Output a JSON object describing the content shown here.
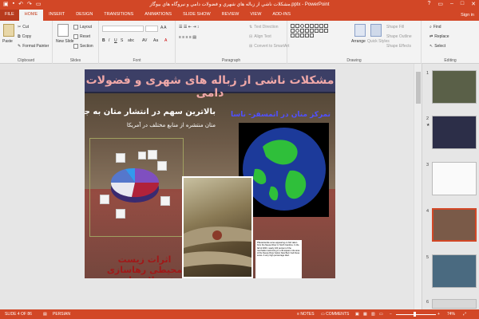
{
  "window": {
    "title": "مشكلات ناشي از زباله هاي شهري و فضولات دامي و نيروگاه هاي بيوگاز.pptx - PowerPoint",
    "signin": "Sign in"
  },
  "tabs": [
    "FILE",
    "HOME",
    "INSERT",
    "DESIGN",
    "TRANSITIONS",
    "ANIMATIONS",
    "SLIDE SHOW",
    "REVIEW",
    "VIEW",
    "ADD-INS"
  ],
  "ribbon": {
    "clipboard": {
      "label": "Clipboard",
      "paste": "Paste",
      "cut": "Cut",
      "copy": "Copy",
      "format_painter": "Format Painter"
    },
    "slides": {
      "label": "Slides",
      "new_slide": "New Slide",
      "layout": "Layout",
      "reset": "Reset",
      "section": "Section"
    },
    "font": {
      "label": "Font"
    },
    "paragraph": {
      "label": "Paragraph",
      "text_direction": "Text Direction",
      "align_text": "Align Text",
      "convert": "Convert to SmartArt"
    },
    "drawing": {
      "label": "Drawing",
      "arrange": "Arrange",
      "quick_styles": "Quick Styles",
      "shape_fill": "Shape Fill",
      "shape_outline": "Shape Outline",
      "shape_effects": "Shape Effects"
    },
    "editing": {
      "label": "Editing",
      "find": "Find",
      "replace": "Replace",
      "select": "Select"
    }
  },
  "slide": {
    "title": "مشکلات ناشی از زباله های شهری و فضولات دامی",
    "subtitle1": "بالاترین سهم در انتشار متان به جو:",
    "subtitle2": "متان منتشره از منابع مختلف در آمریکا",
    "globe_title": "تمرکز متان در اتمسفر- ناسا",
    "bottom_text": "اثرات زیست محیطی رهاسازی فضولات دامی",
    "caption": "Pfiesteria-like sores appearing on fish taken from the Neuse River in North Carolina. In the fall of 2003, nearly 100 percent of the menhaden swimming in a 40-square mile area of the Neuse River below New Bern had these sores. A very high percentage died."
  },
  "thumbnails": [
    "1",
    "2",
    "3",
    "4",
    "5",
    "6"
  ],
  "status": {
    "slide_of": "SLIDE 4 OF 86",
    "language": "PERSIAN",
    "notes": "NOTES",
    "comments": "COMMENTS",
    "zoom": "74%"
  }
}
